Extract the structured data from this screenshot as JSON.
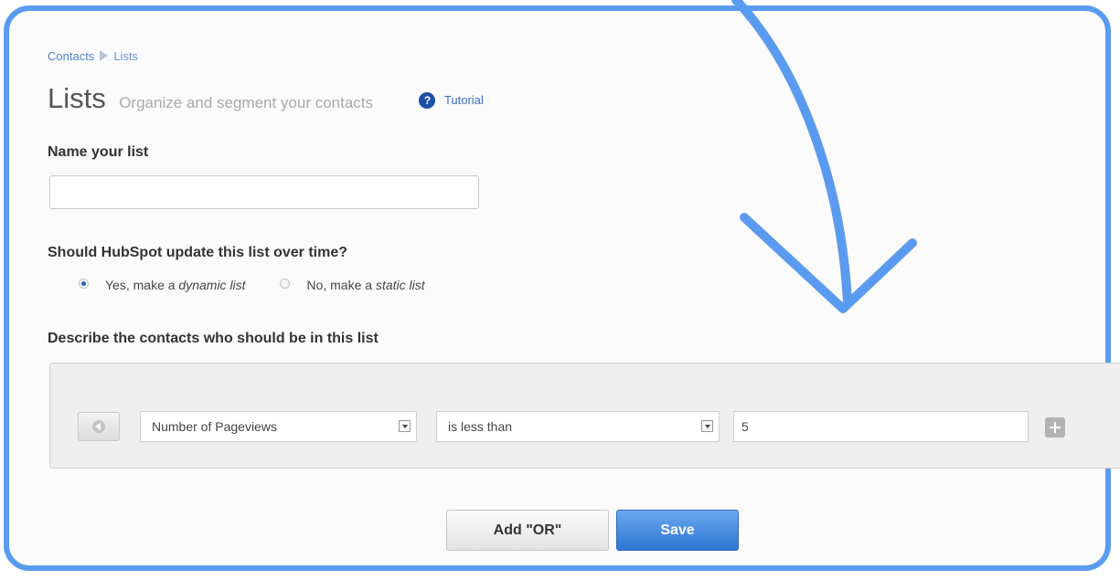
{
  "breadcrumb": {
    "parent": "Contacts",
    "current": "Lists"
  },
  "header": {
    "title": "Lists",
    "subtitle": "Organize and segment your contacts",
    "help_icon": "?",
    "tutorial": "Tutorial"
  },
  "name_section": {
    "label": "Name your list",
    "value": ""
  },
  "update_section": {
    "label": "Should HubSpot update this list over time?",
    "options": [
      {
        "prefix": "Yes, make a ",
        "emph": "dynamic list",
        "selected": true
      },
      {
        "prefix": "No, make a ",
        "emph": "static list",
        "selected": false
      }
    ]
  },
  "criteria_section": {
    "label": "Describe the contacts who should be in this list",
    "filter": {
      "property": "Number of Pageviews",
      "operator": "is less than",
      "value": "5"
    }
  },
  "actions": {
    "add_or": "Add \"OR\"",
    "save": "Save"
  },
  "icons": {
    "breadcrumb_separator": "triangle-right-icon",
    "help": "question-circle-icon",
    "remove_row": "back-arrow-icon",
    "add_row": "plus-icon"
  },
  "colors": {
    "frame_border": "#5b9bef",
    "link": "#4b83c9",
    "save_button": "#3a7fd8",
    "help_icon": "#1e4fa7"
  }
}
